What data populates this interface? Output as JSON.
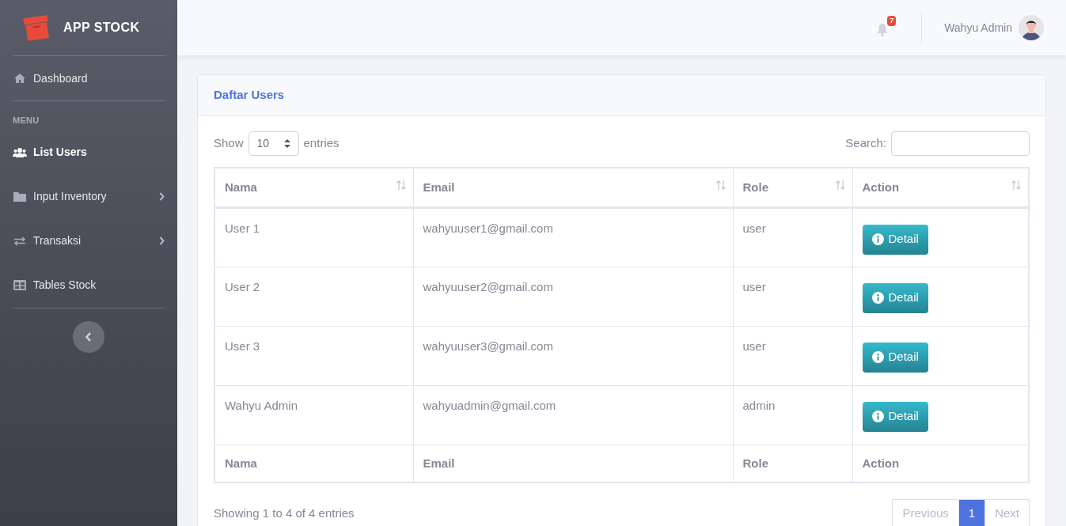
{
  "brand": {
    "title": "APP STOCK"
  },
  "sidebar": {
    "items": [
      {
        "kind": "divider"
      },
      {
        "kind": "link",
        "label": "Dashboard",
        "selected": false,
        "has_submenu": false
      },
      {
        "kind": "divider"
      },
      {
        "kind": "heading",
        "label": "MENU"
      },
      {
        "kind": "link",
        "label": "List Users",
        "selected": true,
        "has_submenu": false
      },
      {
        "kind": "link",
        "label": "Input Inventory",
        "selected": false,
        "has_submenu": true
      },
      {
        "kind": "link",
        "label": "Transaksi",
        "selected": false,
        "has_submenu": true
      },
      {
        "kind": "link",
        "label": "Tables Stock",
        "selected": false,
        "has_submenu": false
      },
      {
        "kind": "divider"
      }
    ]
  },
  "topbar": {
    "notification_count": "7",
    "user_name": "Wahyu Admin"
  },
  "card": {
    "title": "Daftar Users",
    "length": {
      "prefix": "Show",
      "value": "10",
      "suffix": "entries"
    },
    "search": {
      "label": "Search:"
    },
    "table": {
      "columns": [
        "Nama",
        "Email",
        "Role",
        "Action"
      ],
      "rows": [
        {
          "nama": "User 1",
          "email": "wahyuuser1@gmail.com",
          "role": "user",
          "action": "Detail"
        },
        {
          "nama": "User 2",
          "email": "wahyuuser2@gmail.com",
          "role": "user",
          "action": "Detail"
        },
        {
          "nama": "User 3",
          "email": "wahyuuser3@gmail.com",
          "role": "user",
          "action": "Detail"
        },
        {
          "nama": "Wahyu Admin",
          "email": "wahyuadmin@gmail.com",
          "role": "admin",
          "action": "Detail"
        }
      ],
      "footer_columns": [
        "Nama",
        "Email",
        "Role",
        "Action"
      ]
    },
    "info": "Showing 1 to 4 of 4 entries",
    "pagination": [
      {
        "label": "Previous",
        "selected": false,
        "disabled": true
      },
      {
        "label": "1",
        "selected": true,
        "disabled": false
      },
      {
        "label": "Next",
        "selected": false,
        "disabled": true
      }
    ]
  }
}
